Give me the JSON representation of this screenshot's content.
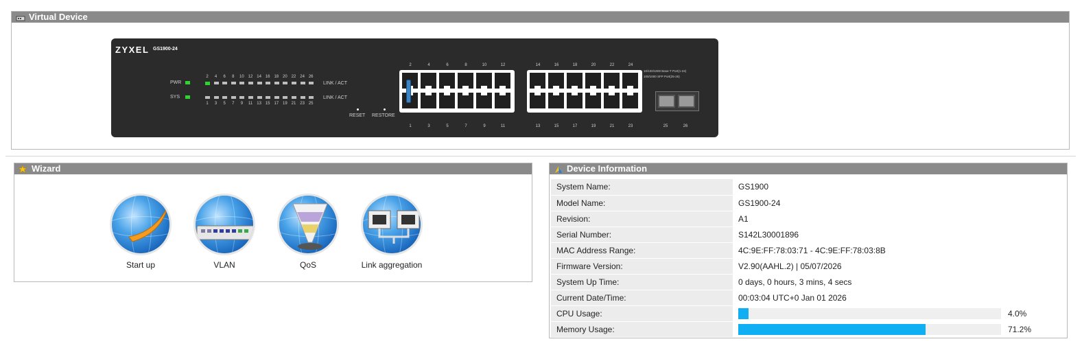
{
  "virtual_device": {
    "title": "Virtual Device",
    "brand": "ZYXEL",
    "model": "GS1900-24",
    "pwr_label": "PWR",
    "sys_label": "SYS",
    "link_act_label": "LINK / ACT",
    "reset_label": "RESET",
    "restore_label": "RESTORE",
    "even_leds": [
      "2",
      "4",
      "6",
      "8",
      "10",
      "12",
      "14",
      "16",
      "18",
      "20",
      "22",
      "24",
      "26"
    ],
    "odd_leds": [
      "1",
      "3",
      "5",
      "7",
      "9",
      "11",
      "13",
      "15",
      "17",
      "19",
      "21",
      "23",
      "25"
    ],
    "ports_top": [
      "2",
      "4",
      "6",
      "8",
      "10",
      "12",
      "14",
      "16",
      "18",
      "20",
      "22",
      "24"
    ],
    "ports_bottom": [
      "1",
      "3",
      "5",
      "7",
      "9",
      "11",
      "13",
      "15",
      "17",
      "19",
      "21",
      "23"
    ],
    "sfp_ports": [
      "25",
      "26"
    ],
    "port_info_1": "10/100/1000 Base-T Port(1-24)",
    "port_info_2": "100/1000 SFP Port(25-26)",
    "active_port": "2",
    "colors": {
      "led_on": "#2fd52f",
      "led_off": "#bdbdbd",
      "cable": "#3c86c8"
    }
  },
  "wizard": {
    "title": "Wizard",
    "items": [
      {
        "label": "Start up",
        "icon": "startup-icon"
      },
      {
        "label": "VLAN",
        "icon": "vlan-icon"
      },
      {
        "label": "QoS",
        "icon": "qos-icon"
      },
      {
        "label": "Link aggregation",
        "icon": "link-aggregation-icon"
      }
    ]
  },
  "device_info": {
    "title": "Device Information",
    "rows": [
      {
        "key": "System Name:",
        "value": "GS1900"
      },
      {
        "key": "Model Name:",
        "value": "GS1900-24"
      },
      {
        "key": "Revision:",
        "value": "A1"
      },
      {
        "key": "Serial Number:",
        "value": "S142L30001896"
      },
      {
        "key": "MAC Address Range:",
        "value": "4C:9E:FF:78:03:71 - 4C:9E:FF:78:03:8B"
      },
      {
        "key": "Firmware Version:",
        "value": "V2.90(AAHL.2) | 05/07/2026"
      },
      {
        "key": "System Up Time:",
        "value": "0 days, 0 hours, 3 mins, 4 secs"
      },
      {
        "key": "Current Date/Time:",
        "value": "00:03:04 UTC+0 Jan 01 2026"
      }
    ],
    "cpu": {
      "key": "CPU Usage:",
      "percent": 4.0,
      "text": "4.0%"
    },
    "memory": {
      "key": "Memory Usage:",
      "percent": 71.2,
      "text": "71.2%"
    },
    "colors": {
      "bar_fill": "#10aef2",
      "bar_track": "#efefef"
    }
  }
}
